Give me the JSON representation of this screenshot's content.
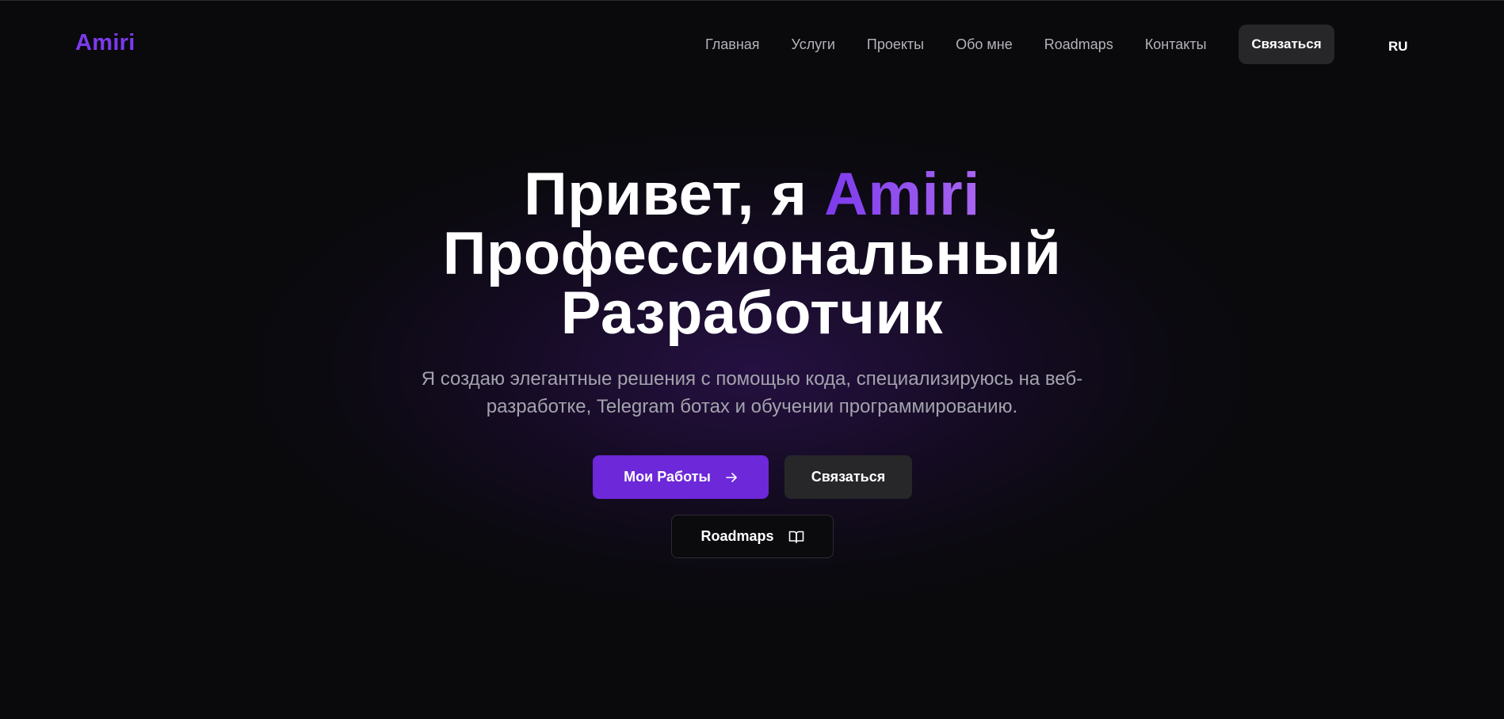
{
  "header": {
    "logo": "Amiri",
    "nav": [
      {
        "label": "Главная"
      },
      {
        "label": "Услуги"
      },
      {
        "label": "Проекты"
      },
      {
        "label": "Обо мне"
      },
      {
        "label": "Roadmaps"
      },
      {
        "label": "Контакты"
      }
    ],
    "contact_button": "Связаться",
    "language": "RU"
  },
  "hero": {
    "greeting": "Привет, я ",
    "name": "Amiri",
    "title_line2": "Профессиональный",
    "title_line3": "Разработчик",
    "subtitle": "Я создаю элегантные решения с помощью кода, специализируюсь на веб-разработке, Telegram ботах и обучении программированию.",
    "buttons": {
      "works": "Мои Работы",
      "contact": "Связаться",
      "roadmaps": "Roadmaps"
    }
  },
  "icons": {
    "works": "arrow-right-icon",
    "roadmaps": "book-open-icon"
  },
  "colors": {
    "background": "#0a0a0c",
    "accent": "#7c3aed",
    "primary_button": "#6d28d9",
    "secondary_button": "#27272a",
    "muted_text": "#a3a3ad"
  }
}
